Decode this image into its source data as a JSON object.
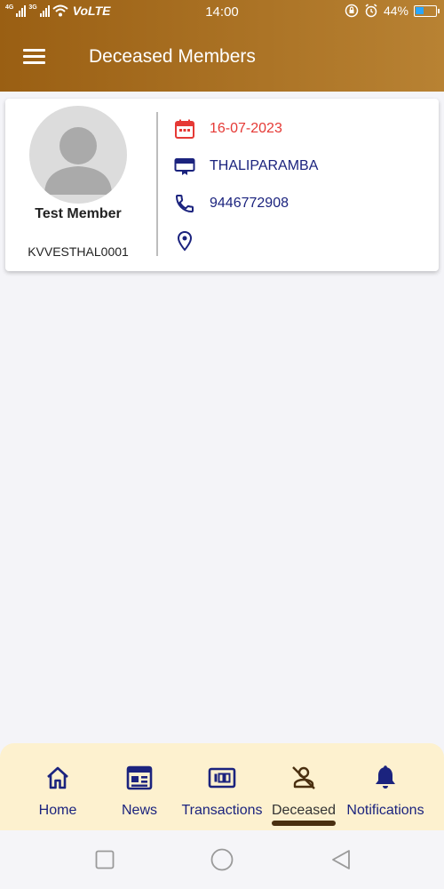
{
  "status_bar": {
    "network_a": "4G",
    "network_b": "3G",
    "volte": "VoLTE",
    "time": "14:00",
    "battery_text": "44%",
    "battery_level": 0.44,
    "battery_color": "#2aa6ff"
  },
  "app_bar": {
    "title": "Deceased Members",
    "menu_icon": "hamburger-menu-icon",
    "gradient_colors": [
      "#9a5f13",
      "#b88233"
    ]
  },
  "member": {
    "avatar_icon": "person-placeholder-icon",
    "name": "Test Member",
    "member_id": "KVVESTHAL0001",
    "date": "16-07-2023",
    "branch": "THALIPARAMBA",
    "phone": "9446772908",
    "address": "",
    "date_color": "#e53935",
    "info_color": "#1b237e"
  },
  "bottom_nav": {
    "active_index": 3,
    "items": [
      {
        "label": "Home",
        "icon": "home-icon"
      },
      {
        "label": "News",
        "icon": "newspaper-icon"
      },
      {
        "label": "Transactions",
        "icon": "counter-icon"
      },
      {
        "label": "Deceased",
        "icon": "person-off-icon"
      },
      {
        "label": "Notifications",
        "icon": "bell-icon"
      }
    ]
  },
  "system_nav": {
    "recents_icon": "square-icon",
    "home_icon": "circle-icon",
    "back_icon": "back-triangle-icon"
  }
}
